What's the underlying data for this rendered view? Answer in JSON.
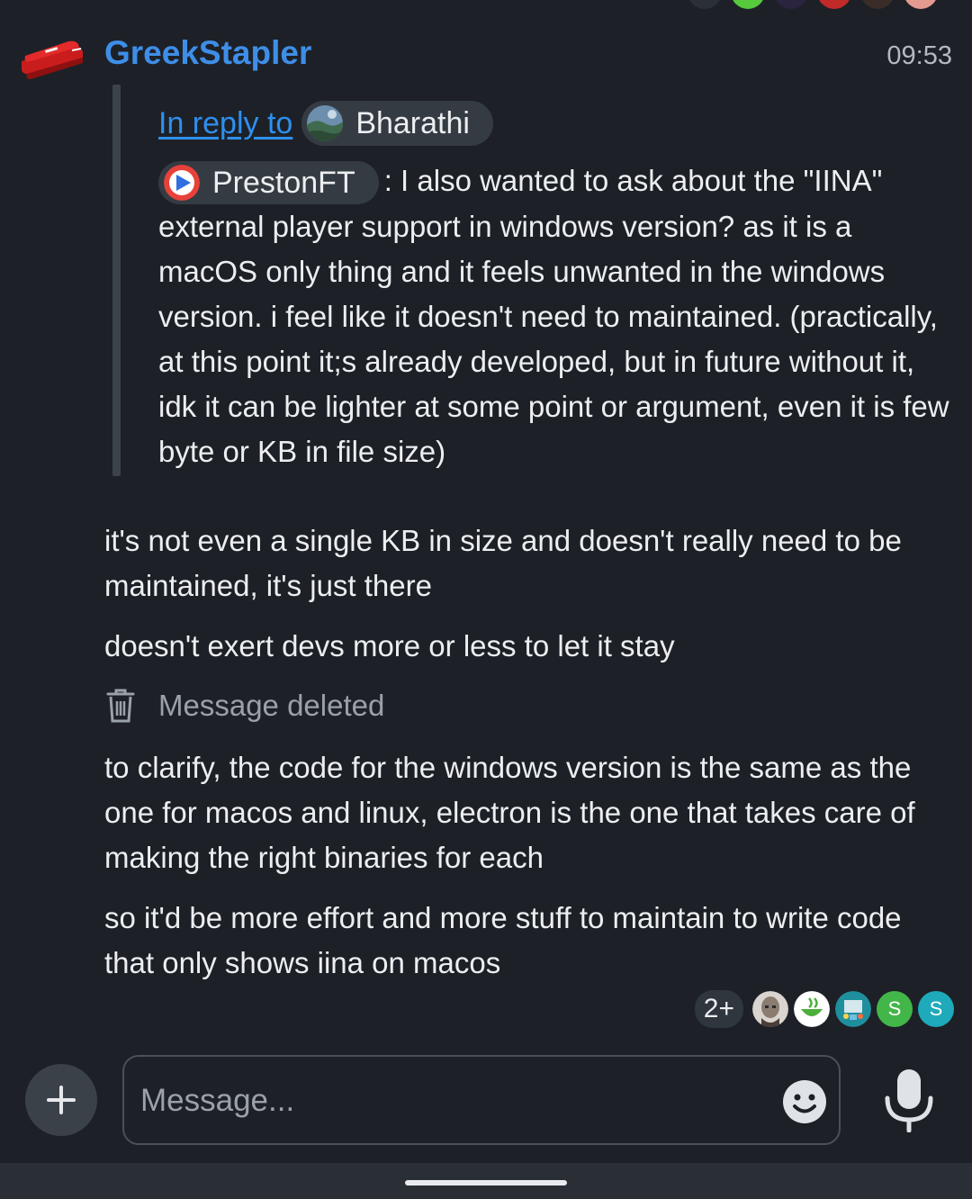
{
  "message": {
    "author": "GreekStapler",
    "time": "09:53",
    "reply": {
      "link_label": "In reply to",
      "replied_user": "Bharathi",
      "quoted_user": "PrestonFT",
      "quoted_text": ": I also wanted to ask about the \"IINA\" external player support in windows version? as it is a macOS only thing and it feels unwanted in the windows version. i feel like it doesn't need to maintained. (practically, at this point it;s already developed, but in future without it, idk it can be lighter at some point or argument, even it is few byte or KB in file size)"
    }
  },
  "messages": [
    "it's not even a single KB in size and doesn't really need to be maintained, it's just there",
    "doesn't exert devs more or less to let it stay",
    "to clarify, the code for the windows version is the same as the one for macos and linux, electron is the one that takes care of making the right binaries for each",
    "so it'd be more effort and more stuff to maintain to write code that only shows iina on macos"
  ],
  "deleted_label": "Message deleted",
  "reactions": {
    "count_label": "2+",
    "letter_a": "S",
    "letter_b": "S"
  },
  "composer": {
    "placeholder": "Message..."
  },
  "colors": {
    "background": "#1d2127",
    "author": "#3e8ee8",
    "link": "#2f8fee",
    "chip": "#353b43",
    "green_avatar": "#43b649",
    "teal_avatar": "#1eaaba"
  }
}
